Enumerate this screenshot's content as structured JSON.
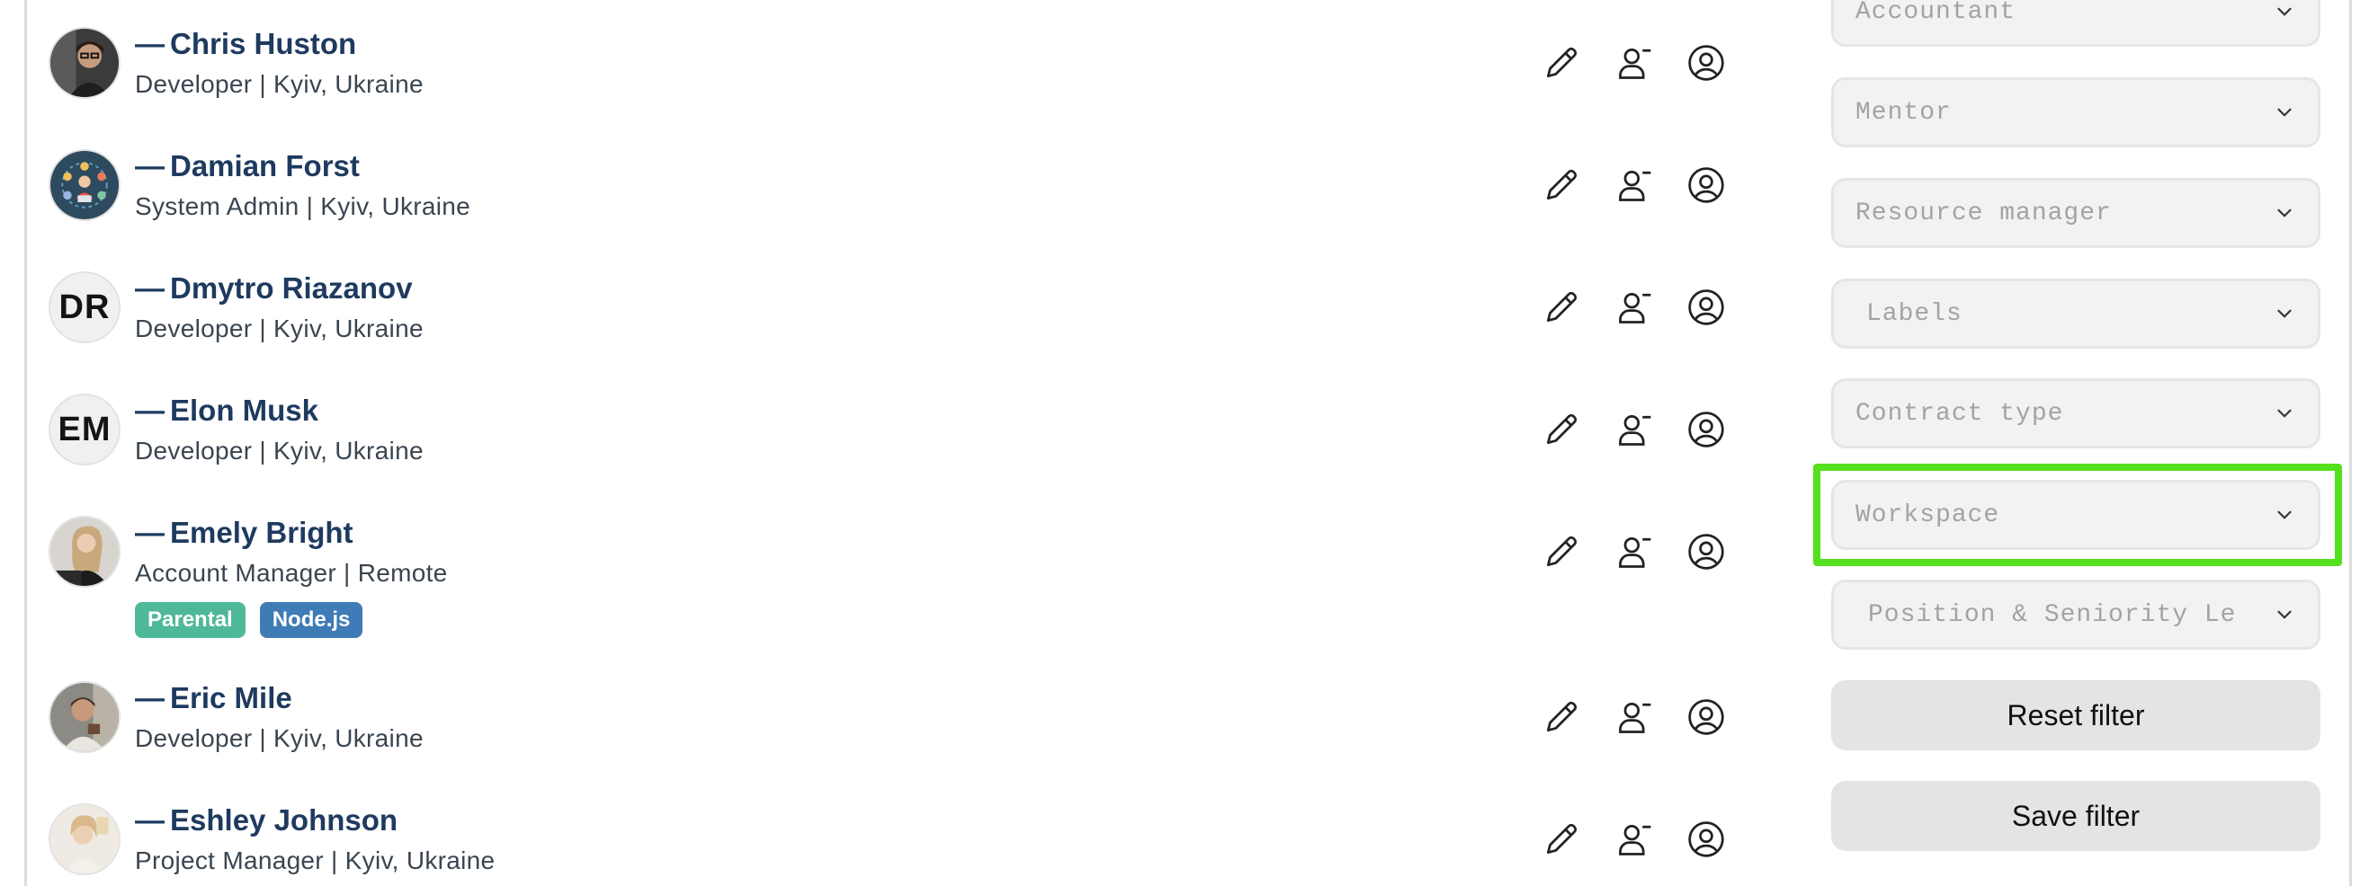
{
  "people": [
    {
      "name": "Chris Huston",
      "dash": "—",
      "meta": "Developer | Kyiv, Ukraine",
      "avatar": "photo",
      "tags": []
    },
    {
      "name": "Damian Forst",
      "dash": "—",
      "meta": "System Admin | Kyiv, Ukraine",
      "avatar": "photo",
      "tags": []
    },
    {
      "name": "Dmytro Riazanov",
      "dash": "—",
      "meta": "Developer | Kyiv, Ukraine",
      "avatar": "initials",
      "initials": "DR",
      "tags": []
    },
    {
      "name": "Elon Musk",
      "dash": "—",
      "meta": "Developer | Kyiv, Ukraine",
      "avatar": "initials",
      "initials": "EM",
      "tags": []
    },
    {
      "name": "Emely Bright",
      "dash": "—",
      "meta": "Account Manager | Remote",
      "avatar": "photo",
      "tags": [
        {
          "label": "Parental",
          "color": "#4fb898"
        },
        {
          "label": "Node.js",
          "color": "#3f7bb6"
        }
      ]
    },
    {
      "name": "Eric Mile",
      "dash": "—",
      "meta": "Developer | Kyiv, Ukraine",
      "avatar": "photo",
      "tags": []
    },
    {
      "name": "Eshley Johnson",
      "dash": "—",
      "meta": "Project Manager | Kyiv, Ukraine",
      "avatar": "photo",
      "tags": []
    }
  ],
  "row_actions": {
    "edit": "pencil-icon",
    "remove": "user-minus-icon",
    "profile": "user-circle-icon"
  },
  "filters": {
    "selects": [
      {
        "placeholder": "Accountant"
      },
      {
        "placeholder": "Mentor"
      },
      {
        "placeholder": "Resource manager"
      },
      {
        "placeholder": "Labels"
      },
      {
        "placeholder": "Contract type"
      },
      {
        "placeholder": "Workspace"
      },
      {
        "placeholder": "Position & Seniority Lev"
      }
    ],
    "reset_label": "Reset filter",
    "save_label": "Save filter"
  },
  "colors": {
    "name": "#1e3a5f",
    "highlight": "#55e01f",
    "select_bg": "#f2f2f2",
    "button_bg": "#e4e4e6"
  }
}
